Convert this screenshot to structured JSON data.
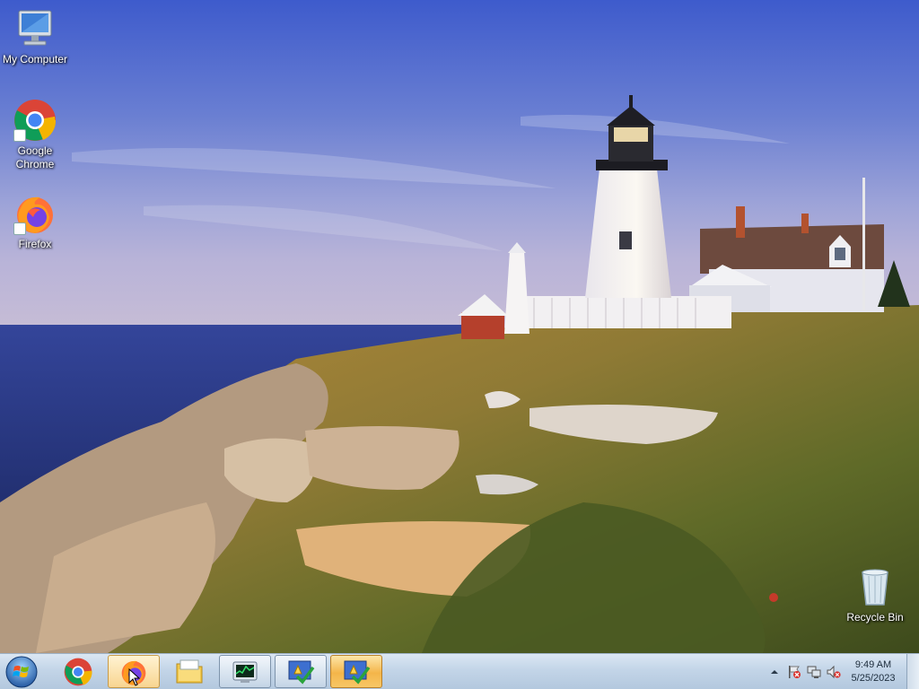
{
  "desktop": {
    "icons": [
      {
        "label": "My Computer"
      },
      {
        "label": "Google Chrome"
      },
      {
        "label": "Firefox"
      },
      {
        "label": "Recycle Bin"
      }
    ]
  },
  "taskbar": {
    "buttons": [
      {
        "icon": "chrome-icon",
        "state": "pinned"
      },
      {
        "icon": "firefox-icon",
        "state": "hover"
      },
      {
        "icon": "explorer-folder-icon",
        "state": "pinned"
      },
      {
        "icon": "task-manager-icon",
        "state": "running"
      },
      {
        "icon": "checkmark-app-icon",
        "state": "running"
      },
      {
        "icon": "checkmark-app-icon",
        "state": "active"
      }
    ],
    "tray": {
      "icons": [
        "show-hidden-icons-arrow",
        "action-center-flag-icon",
        "network-icon",
        "volume-muted-icon"
      ],
      "time": "9:49 AM",
      "date": "5/25/2023"
    }
  },
  "colors": {
    "taskbar_active": "#f4b54a",
    "sky_top": "#4561c8",
    "sea": "#2b3e86"
  }
}
